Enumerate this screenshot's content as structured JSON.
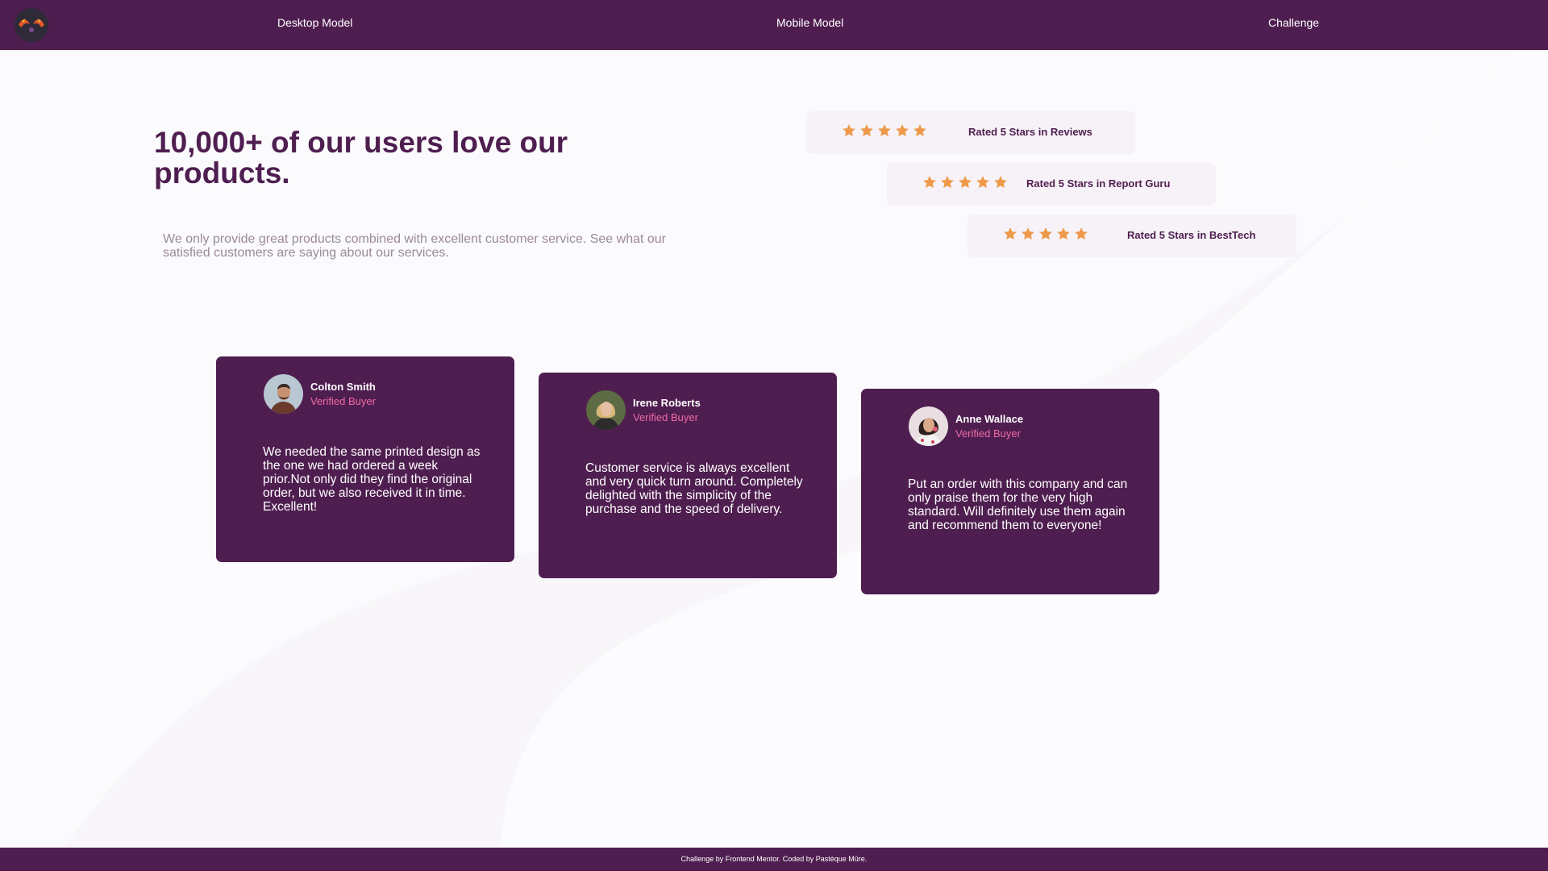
{
  "nav": {
    "logo": "logo-icon",
    "links": [
      {
        "label": "Desktop Model"
      },
      {
        "label": "Mobile Model"
      },
      {
        "label": "Challenge"
      }
    ]
  },
  "hero": {
    "title": "10,000+ of our users love our products.",
    "description": "We only provide great products combined with excellent customer service. See what our satisfied customers are saying about our services."
  },
  "ratings": [
    {
      "stars": 5,
      "label": "Rated 5 Stars in Reviews"
    },
    {
      "stars": 5,
      "label": "Rated 5 Stars in Report Guru"
    },
    {
      "stars": 5,
      "label": "Rated 5 Stars in BestTech"
    }
  ],
  "testimonials": [
    {
      "name": "Colton Smith",
      "role": "Verified Buyer",
      "quote": "We needed the same printed design as the one we had ordered a week prior.Not only did they find the original order, but we also received it in time. Excellent!"
    },
    {
      "name": "Irene Roberts",
      "role": "Verified Buyer",
      "quote": "Customer service is always excellent and very quick turn around. Completely delighted with the simplicity of the purchase and the speed of delivery."
    },
    {
      "name": "Anne Wallace",
      "role": "Verified Buyer",
      "quote": "Put an order with this company and can only praise them for the very high standard. Will definitely use them again and recommend them to everyone!"
    }
  ],
  "footer": {
    "text": "Challenge by Frontend Mentor. Coded by Pastèque Mûre."
  },
  "colors": {
    "brand": "#4f1e50",
    "accent_pink": "#ee6aa7",
    "star": "#ee9a4a",
    "rating_bg": "#f6f2f7"
  }
}
